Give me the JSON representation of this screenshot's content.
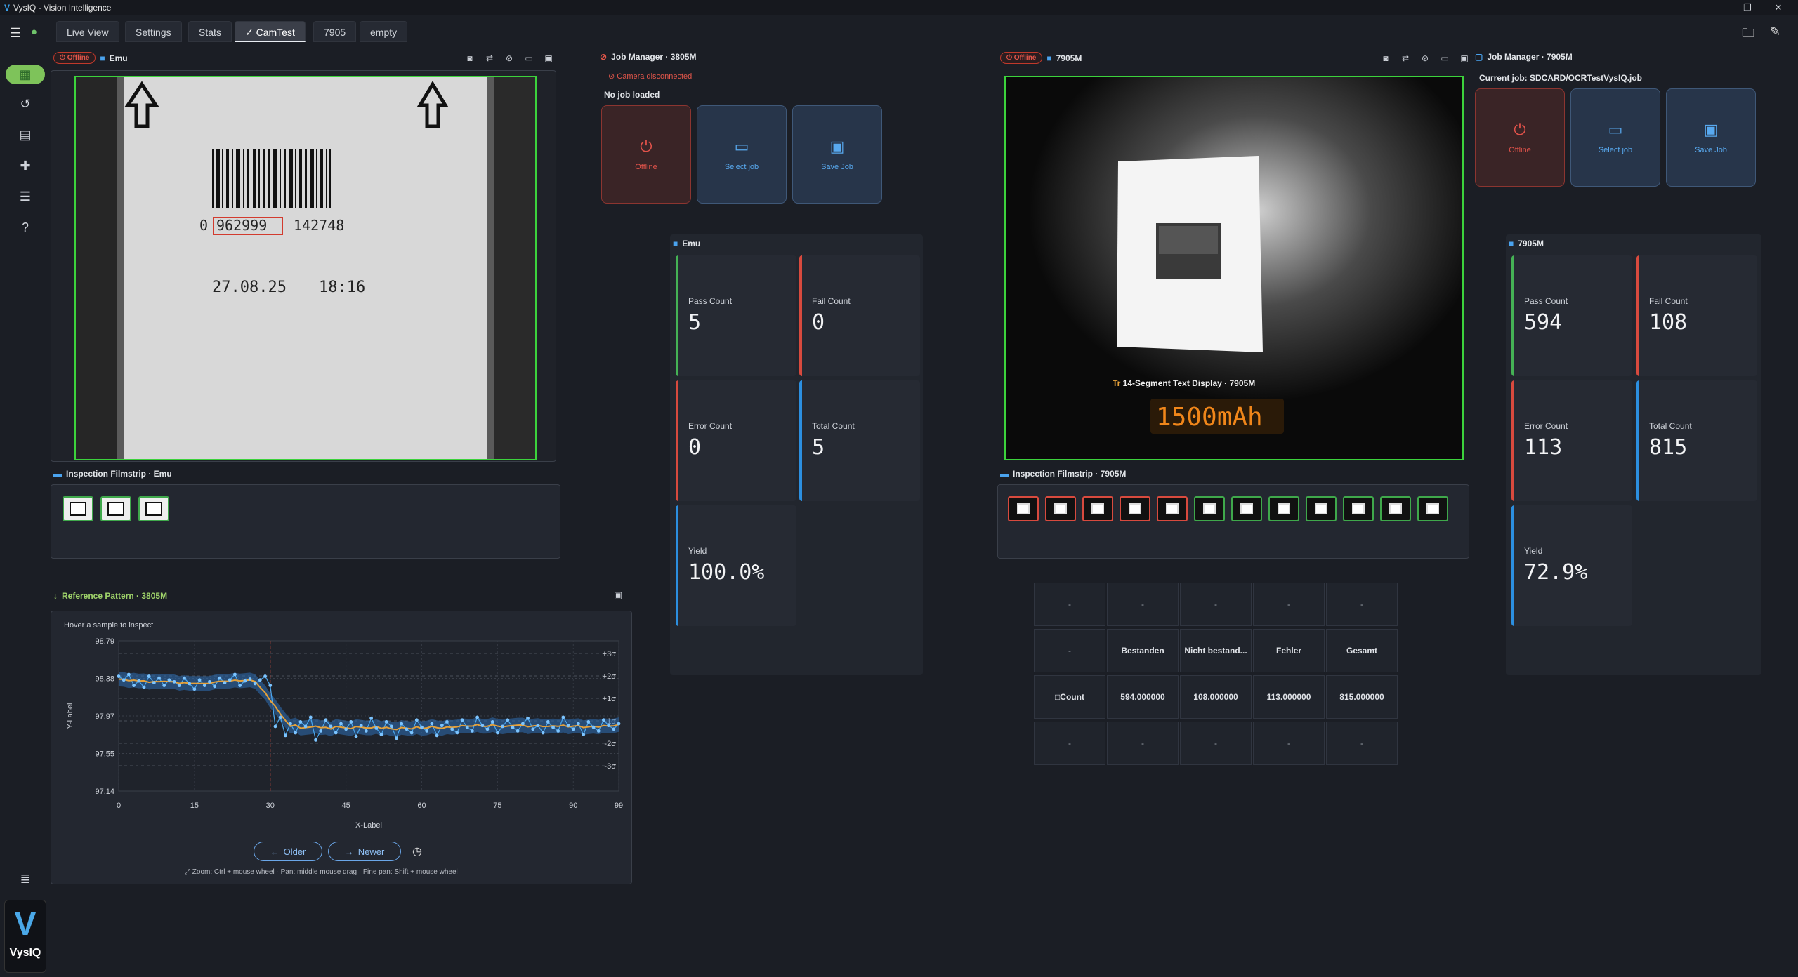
{
  "window": {
    "title": "VysIQ - Vision Intelligence",
    "logo": "V"
  },
  "tabs": [
    {
      "label": "Live View"
    },
    {
      "label": "Settings"
    },
    {
      "label": "Stats"
    },
    {
      "label": "CamTest",
      "active": true
    },
    {
      "label": "7905"
    },
    {
      "label": "empty"
    }
  ],
  "sidebar": {
    "icons": [
      "grid-icon",
      "history-icon",
      "document-icon",
      "plugin-icon",
      "list-icon",
      "help-icon",
      "storage-icon"
    ],
    "brand": "VysIQ"
  },
  "cam1": {
    "status": "Offline",
    "name": "Emu",
    "barcode_digits": "0",
    "barcode_box": "962999",
    "barcode_rest": "142748",
    "date": "27.08.25",
    "time": "18:16"
  },
  "job1": {
    "title": "Job Manager · 3805M",
    "status": "Camera disconnected",
    "job": "No job loaded",
    "buttons": {
      "offline": "Offline",
      "select": "Select job",
      "save": "Save Job"
    }
  },
  "stats1": {
    "title": "Emu",
    "pass_label": "Pass Count",
    "pass": "5",
    "fail_label": "Fail Count",
    "fail": "0",
    "error_label": "Error Count",
    "error": "0",
    "total_label": "Total Count",
    "total": "5",
    "yield_label": "Yield",
    "yield": "100.0%"
  },
  "film1": {
    "title": "Inspection Filmstrip · Emu",
    "thumbs": 3
  },
  "ref": {
    "title": "Reference Pattern · 3805M",
    "hint": "Hover a sample to inspect",
    "older": "Older",
    "newer": "Newer",
    "footer": "Zoom: Ctrl + mouse wheel · Pan: middle mouse drag · Fine pan: Shift + mouse wheel"
  },
  "chart_data": {
    "type": "line",
    "xlabel": "X-Label",
    "ylabel": "Y-Label",
    "ylim": [
      97.14,
      98.79
    ],
    "yticks": [
      "98.79",
      "98.38",
      "97.97",
      "97.55",
      "97.14"
    ],
    "xticks": [
      "0",
      "15",
      "30",
      "45",
      "60",
      "75",
      "90",
      "99"
    ],
    "sigma_labels": [
      "+3σ",
      "+2σ",
      "+1σ",
      "-1σ",
      "-2σ",
      "-3σ"
    ],
    "series": [
      {
        "values": [
          98.4,
          98.36,
          98.42,
          98.3,
          98.35,
          98.28,
          98.4,
          98.33,
          98.38,
          98.3,
          98.36,
          98.34,
          98.3,
          98.38,
          98.32,
          98.26,
          98.36,
          98.3,
          98.34,
          98.29,
          98.38,
          98.33,
          98.36,
          98.42,
          98.3,
          98.35,
          98.37,
          98.32,
          98.36,
          98.4,
          98.3,
          97.85,
          97.95,
          97.75,
          97.88,
          97.78,
          97.9,
          97.85,
          97.95,
          97.7,
          97.8,
          97.92,
          97.85,
          97.78,
          97.88,
          97.82,
          97.9,
          97.74,
          97.86,
          97.8,
          97.94,
          97.83,
          97.76,
          97.9,
          97.85,
          97.72,
          97.88,
          97.82,
          97.78,
          97.92,
          97.84,
          97.8,
          97.88,
          97.75,
          97.86,
          97.9,
          97.82,
          97.78,
          97.92,
          97.84,
          97.8,
          97.95,
          97.86,
          97.82,
          97.9,
          97.78,
          97.85,
          97.92,
          97.84,
          97.8,
          97.88,
          97.94,
          97.82,
          97.86,
          97.78,
          97.9,
          97.84,
          97.8,
          97.95,
          97.86,
          97.82,
          97.88,
          97.76,
          97.9,
          97.84,
          97.8,
          97.92,
          97.86,
          97.82,
          97.88
        ]
      }
    ]
  },
  "cam2": {
    "status": "Offline",
    "name": "7905M",
    "seg_title": "14-Segment Text Display · 7905M",
    "seg_value": "1500mAh"
  },
  "job2": {
    "title": "Job Manager · 7905M",
    "job": "Current job: SDCARD/OCRTestVysIQ.job",
    "buttons": {
      "offline": "Offline",
      "select": "Select job",
      "save": "Save Job"
    }
  },
  "stats2": {
    "title": "7905M",
    "pass_label": "Pass Count",
    "pass": "594",
    "fail_label": "Fail Count",
    "fail": "108",
    "error_label": "Error Count",
    "error": "113",
    "total_label": "Total Count",
    "total": "815",
    "yield_label": "Yield",
    "yield": "72.9%"
  },
  "film2": {
    "title": "Inspection Filmstrip · 7905M",
    "thumbs": [
      "fail",
      "fail",
      "fail",
      "fail",
      "fail",
      "pass",
      "pass",
      "pass",
      "pass",
      "pass",
      "pass",
      "pass"
    ]
  },
  "table": {
    "rows": [
      [
        "-",
        "-",
        "-",
        "-",
        "-"
      ],
      [
        "-",
        "Bestanden",
        "Nicht bestand...",
        "Fehler",
        "Gesamt"
      ],
      [
        "□Count",
        "594.000000",
        "108.000000",
        "113.000000",
        "815.000000"
      ],
      [
        "-",
        "-",
        "-",
        "-",
        "-"
      ]
    ]
  }
}
